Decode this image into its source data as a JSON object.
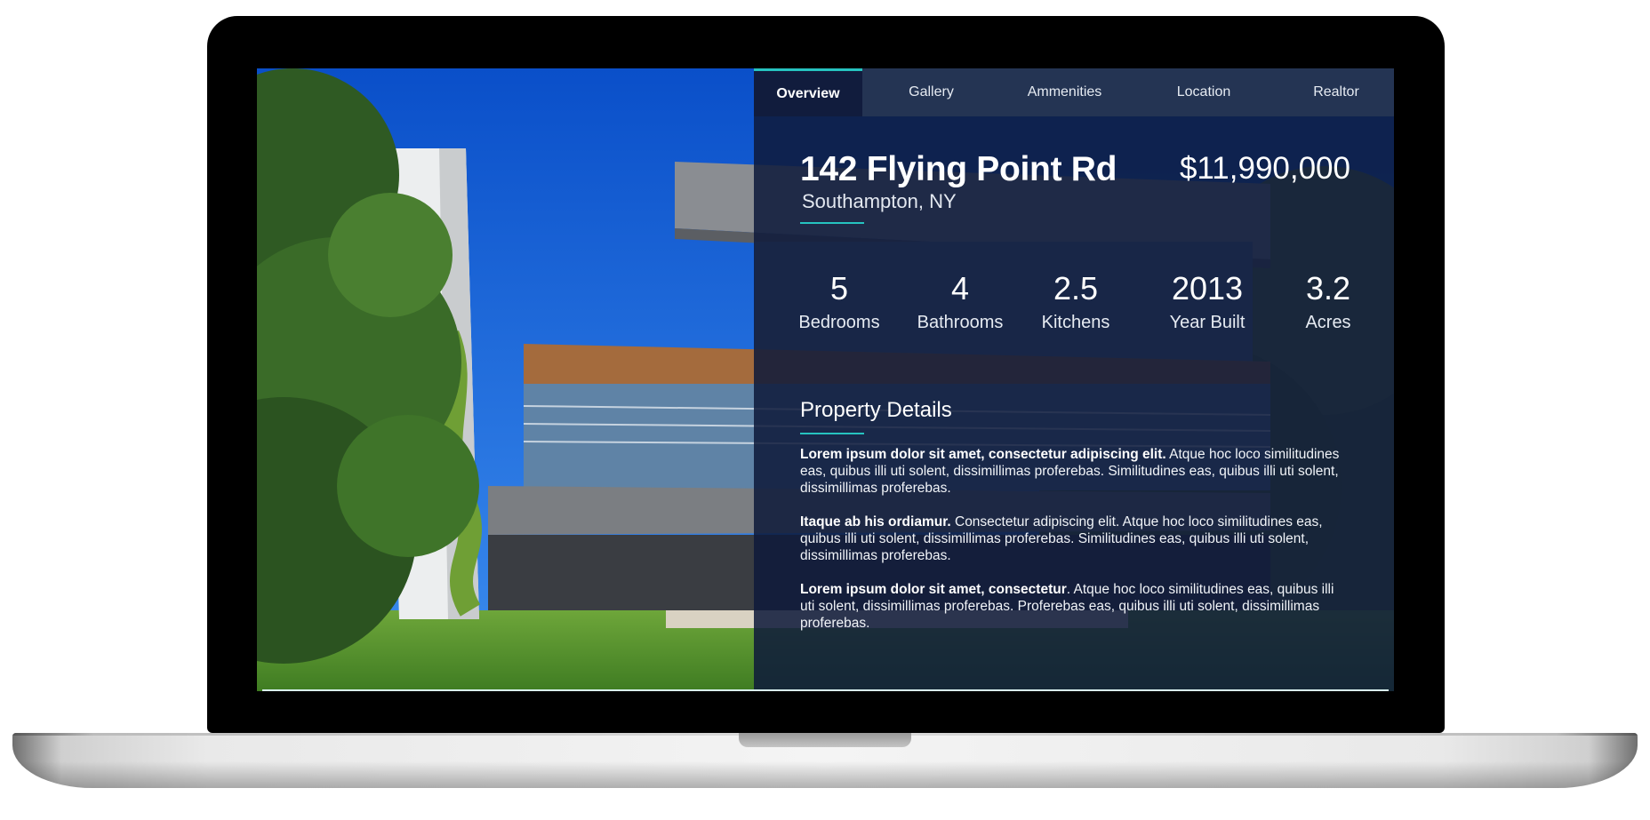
{
  "tabs": [
    {
      "label": "Overview",
      "active": true
    },
    {
      "label": "Gallery",
      "active": false
    },
    {
      "label": "Ammenities",
      "active": false
    },
    {
      "label": "Location",
      "active": false
    },
    {
      "label": "Realtor",
      "active": false
    }
  ],
  "listing": {
    "address": "142 Flying Point Rd",
    "city": "Southampton, NY",
    "price": "$11,990,000"
  },
  "stats": [
    {
      "value": "5",
      "label": "Bedrooms"
    },
    {
      "value": "4",
      "label": "Bathrooms"
    },
    {
      "value": "2.5",
      "label": "Kitchens"
    },
    {
      "value": "2013",
      "label": "Year Built"
    },
    {
      "value": "3.2",
      "label": "Acres"
    }
  ],
  "details": {
    "title": "Property Details",
    "paragraphs": [
      {
        "lead": "Lorem ipsum dolor sit amet, consectetur adipiscing elit.",
        "body": " Atque hoc loco similitudines eas, quibus illi uti solent, dissimillimas proferebas. Similitudines eas, quibus illi uti solent, dissimillimas proferebas."
      },
      {
        "lead": "Itaque ab his ordiamur.",
        "body": " Consectetur adipiscing elit. Atque hoc loco similitudines eas, quibus illi uti solent, dissimillimas proferebas. Similitudines eas, quibus illi uti solent, dissimillimas proferebas."
      },
      {
        "lead": "Lorem ipsum dolor sit amet, consectetur",
        "body": ". Atque hoc loco similitudines eas, quibus illi uti solent, dissimillimas proferebas. Proferebas  eas, quibus illi uti solent, dissimillimas proferebas."
      }
    ]
  },
  "colors": {
    "accent": "#26c3c0",
    "panel": "#0e1a3a",
    "tab_bar": "#263654"
  }
}
